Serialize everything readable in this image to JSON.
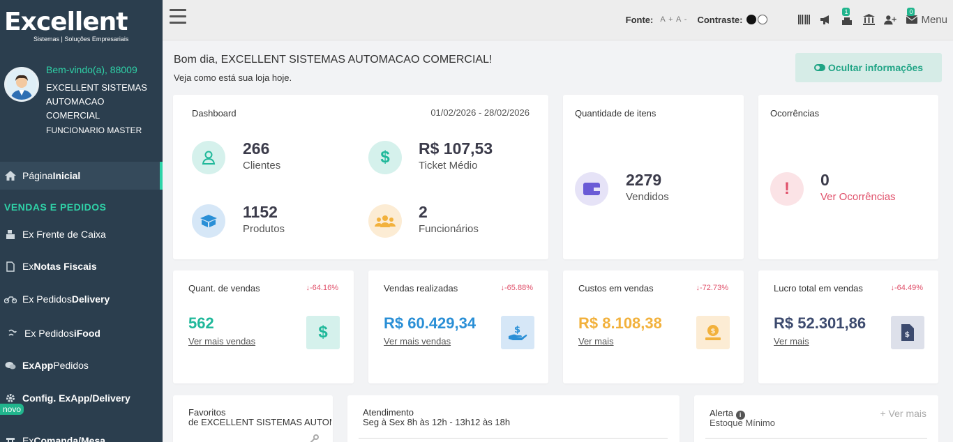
{
  "brand": {
    "name": "Excellent",
    "tagline": "Sistemas | Soluções Empresariais"
  },
  "user": {
    "welcome": "Bem-vindo(a), 88009",
    "company_lines": [
      "EXCELLENT SISTEMAS",
      "AUTOMACAO",
      "COMERCIAL"
    ],
    "role": "FUNCIONARIO MASTER"
  },
  "sidebar": {
    "home": {
      "plain": "Página ",
      "bold": "Inicial"
    },
    "section": "VENDAS E PEDIDOS",
    "items": [
      {
        "plain": "Ex Frente de Caixa",
        "bold": ""
      },
      {
        "plain": "Ex ",
        "bold": "Notas Fiscais"
      },
      {
        "plain": "Ex Pedidos ",
        "bold": "Delivery"
      },
      {
        "plain": "Ex Pedidos ",
        "bold": "iFood"
      },
      {
        "bold": "ExApp",
        "plain": " Pedidos"
      },
      {
        "bold": "Config. ExApp/Delivery",
        "plain": ""
      },
      {
        "plain": "Ex ",
        "bold": "Comanda/Mesa"
      }
    ],
    "new_badge": "novo"
  },
  "topbar": {
    "font_label": "Fonte:",
    "font_controls": "A + A -",
    "contrast_label": "Contraste:",
    "badge_a": "1",
    "badge_b": "0",
    "menu_label": "Menu",
    "icons": [
      "barcode-icon",
      "megaphone-icon",
      "cash-register-icon",
      "bank-icon",
      "add-user-icon",
      "envelope-icon"
    ]
  },
  "greeting": {
    "title": "Bom dia, EXCELLENT SISTEMAS AUTOMACAO COMERCIAL!",
    "subtitle": "Veja como está sua loja hoje.",
    "hide_button": "Ocultar informações"
  },
  "dashboard": {
    "title": "Dashboard",
    "period": "01/02/2026 - 28/02/2026",
    "metrics": [
      {
        "value": "266",
        "label": "Clientes"
      },
      {
        "value": "R$ 107,53",
        "label": "Ticket Médio"
      },
      {
        "value": "1152",
        "label": "Produtos"
      },
      {
        "value": "2",
        "label": "Funcionários"
      }
    ]
  },
  "items_card": {
    "title": "Quantidade de itens",
    "value": "2279",
    "label": "Vendidos"
  },
  "occurrences_card": {
    "title": "Ocorrências",
    "value": "0",
    "link": "Ver Ocorrências"
  },
  "stats": [
    {
      "title": "Quant. de vendas",
      "pct": "↓-64.16%",
      "value": "562",
      "link": "Ver mais vendas",
      "color": "#1fb89a"
    },
    {
      "title": "Vendas realizadas",
      "pct": "↓-65.88%",
      "value": "R$ 60.429,34",
      "link": "Ver mais vendas",
      "color": "#2a8fd6"
    },
    {
      "title": "Custos em vendas",
      "pct": "↓-72.73%",
      "value": "R$ 8.108,38",
      "link": "Ver mais",
      "color": "#f2b13c"
    },
    {
      "title": "Lucro total em vendas",
      "pct": "↓-64.49%",
      "value": "R$ 52.301,86",
      "link": "Ver mais",
      "color": "#3c4a6e"
    }
  ],
  "bottom": {
    "favorites": {
      "title": "Favoritos",
      "subtitle": "de EXCELLENT SISTEMAS AUTOMA"
    },
    "service": {
      "title": "Atendimento",
      "subtitle": "Seg à Sex 8h às 12h - 13h12 às 18h"
    },
    "alert": {
      "title": "Alerta",
      "subtitle": "Estoque Mínimo",
      "more": "+ Ver mais"
    }
  },
  "colors": {
    "sidebar_bg": "#2b3e4e",
    "accent": "#2fd3a8",
    "negative": "#e0506a"
  }
}
